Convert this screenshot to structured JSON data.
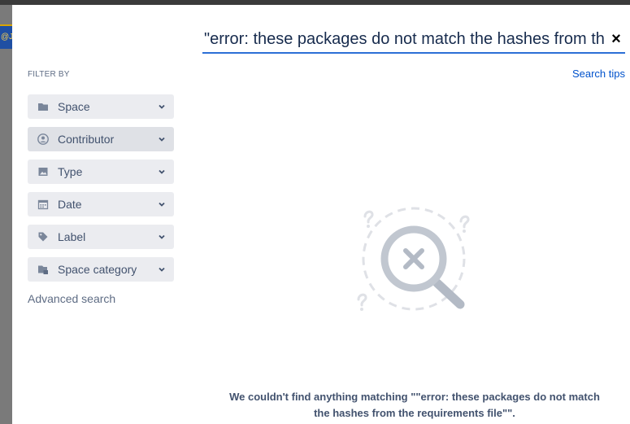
{
  "behind": {
    "fragment": "@J"
  },
  "search": {
    "value": "\"error: these packages do not match the hashes from the requirements file\"",
    "clear_icon": "close-icon"
  },
  "search_tips": "Search tips",
  "filter_by": "FILTER BY",
  "filters": [
    {
      "label": "Space",
      "icon": "folder-icon"
    },
    {
      "label": "Contributor",
      "icon": "user-icon"
    },
    {
      "label": "Type",
      "icon": "image-icon"
    },
    {
      "label": "Date",
      "icon": "calendar-icon"
    },
    {
      "label": "Label",
      "icon": "tag-icon"
    },
    {
      "label": "Space category",
      "icon": "folder-category-icon"
    }
  ],
  "advanced_search": "Advanced search",
  "empty": {
    "line1": "We couldn't find anything matching \"\"error: these packages do not match",
    "line2": "the hashes from the requirements file\"\"."
  },
  "colors": {
    "accent": "#2c6fd6",
    "link": "#0052cc",
    "filter_bg": "#ebecf0",
    "text": "#42526e"
  }
}
